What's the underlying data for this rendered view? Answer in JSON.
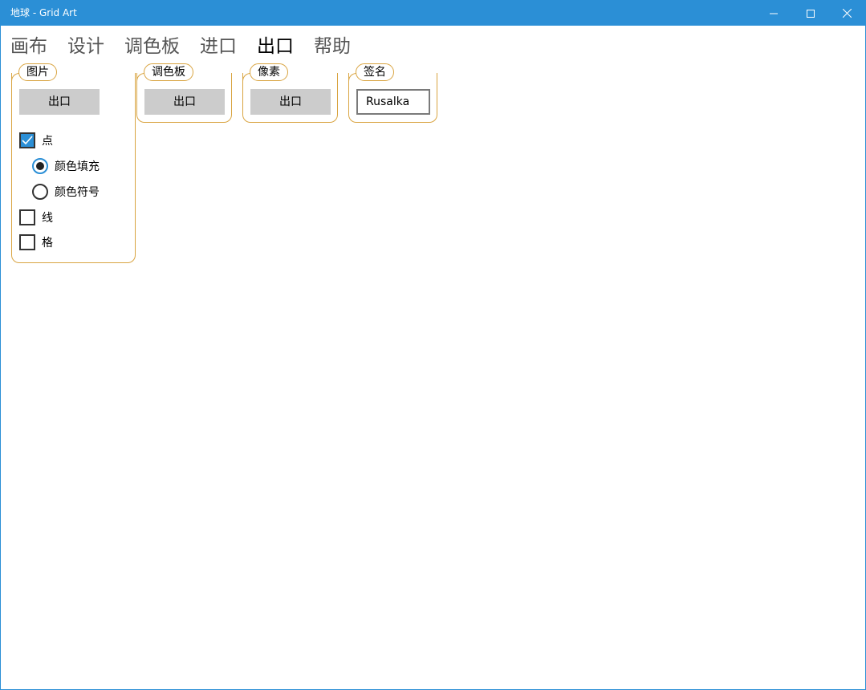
{
  "window": {
    "title": "地球 - Grid Art",
    "minimize_icon": "minimize-icon",
    "maximize_icon": "maximize-icon",
    "close_icon": "close-icon",
    "accent": "#2b8fd6"
  },
  "menu": {
    "items": [
      {
        "label": "画布"
      },
      {
        "label": "设计"
      },
      {
        "label": "调色板"
      },
      {
        "label": "进口"
      },
      {
        "label": "出口"
      },
      {
        "label": "帮助"
      }
    ],
    "active": "出口"
  },
  "groups": {
    "picture": {
      "legend": "图片",
      "export_label": "出口",
      "options": {
        "dots": {
          "label": "点",
          "checked": true
        },
        "color_fill": {
          "label": "颜色填充",
          "selected": true
        },
        "color_symbol": {
          "label": "颜色符号",
          "selected": false
        },
        "lines": {
          "label": "线",
          "checked": false
        },
        "grid": {
          "label": "格",
          "checked": false
        }
      }
    },
    "palette": {
      "legend": "调色板",
      "export_label": "出口"
    },
    "pixels": {
      "legend": "像素",
      "export_label": "出口"
    },
    "signature": {
      "legend": "签名",
      "value": "Rusalka"
    }
  },
  "colors": {
    "group_border": "#d9a441",
    "button_bg": "#cccccc"
  }
}
